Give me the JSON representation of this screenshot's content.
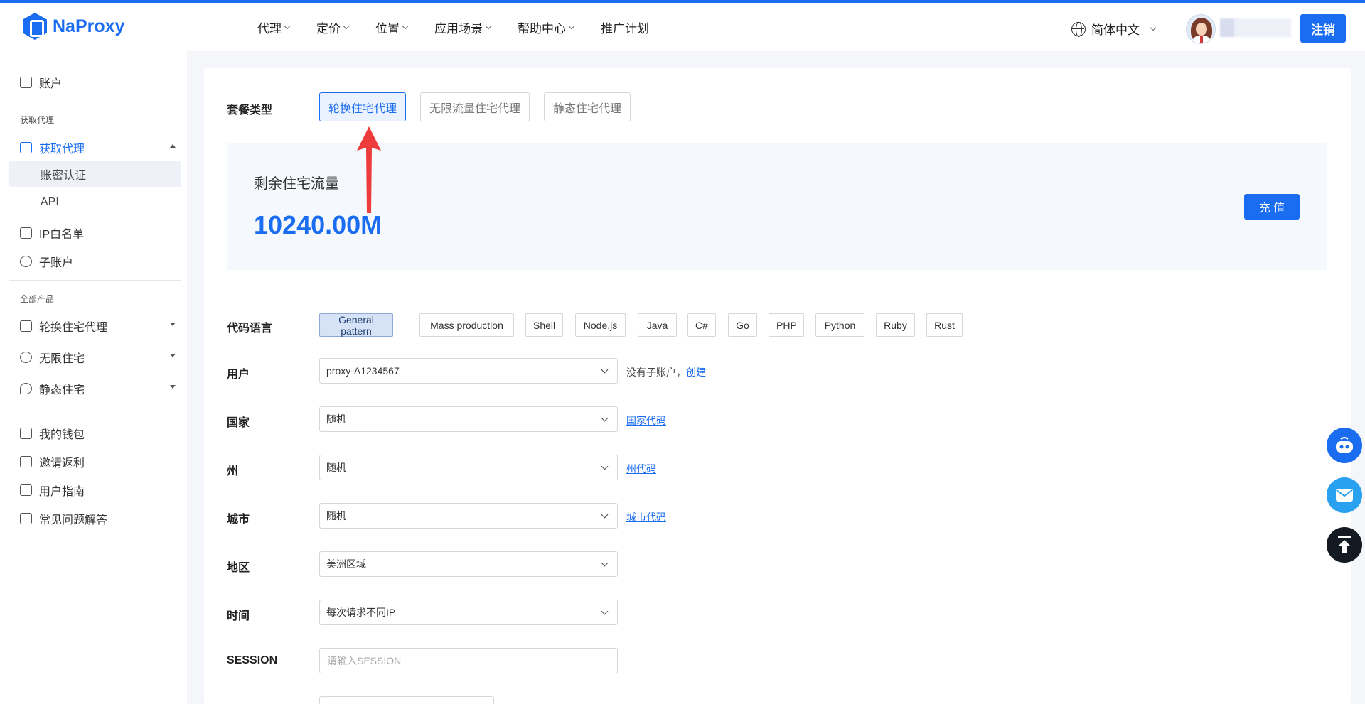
{
  "brand": {
    "name": "NaProxy",
    "accent": "#1a6cf0"
  },
  "nav": [
    {
      "label": "代理",
      "has_menu": true
    },
    {
      "label": "定价",
      "has_menu": true
    },
    {
      "label": "位置",
      "has_menu": true
    },
    {
      "label": "应用场景",
      "has_menu": true
    },
    {
      "label": "帮助中心",
      "has_menu": true
    },
    {
      "label": "推广计划",
      "has_menu": false
    }
  ],
  "header": {
    "language": "简体中文",
    "logout": "注销"
  },
  "sidebar": {
    "account": "账户",
    "section_get_proxy": "获取代理",
    "get_proxy": "获取代理",
    "sub_items": [
      "账密认证",
      "API"
    ],
    "ip_whitelist": "IP白名单",
    "sub_account": "子账户",
    "section_all_products": "全部产品",
    "products": [
      "轮换住宅代理",
      "无限住宅",
      "静态住宅"
    ],
    "wallet": "我的钱包",
    "invite": "邀请返利",
    "guide": "用户指南",
    "faq": "常见问题解答"
  },
  "main": {
    "plan_type_label": "套餐类型",
    "plan_types": [
      "轮换住宅代理",
      "无限流量住宅代理",
      "静态住宅代理"
    ],
    "active_plan": 0,
    "traffic_label": "剩余住宅流量",
    "traffic_value": "10240.00M",
    "recharge": "充 值",
    "code_language_label": "代码语言",
    "code_languages": [
      "General pattern",
      "Mass production",
      "Shell",
      "Node.js",
      "Java",
      "C#",
      "Go",
      "PHP",
      "Python",
      "Ruby",
      "Rust"
    ],
    "active_language": 0,
    "user": {
      "label": "用户",
      "value": "proxy-A1234567",
      "helper": "没有子账户，",
      "link": "创建"
    },
    "country": {
      "label": "国家",
      "value": "随机",
      "link": "国家代码"
    },
    "state": {
      "label": "州",
      "value": "随机",
      "link": "州代码"
    },
    "city": {
      "label": "城市",
      "value": "随机",
      "link": "城市代码"
    },
    "region": {
      "label": "地区",
      "value": "美洲区域"
    },
    "time": {
      "label": "时间",
      "value": "每次请求不同IP"
    },
    "session": {
      "label": "SESSION",
      "placeholder": "请输入SESSION"
    }
  },
  "floating": [
    "robot-icon",
    "mail-icon",
    "back-to-top-icon"
  ]
}
